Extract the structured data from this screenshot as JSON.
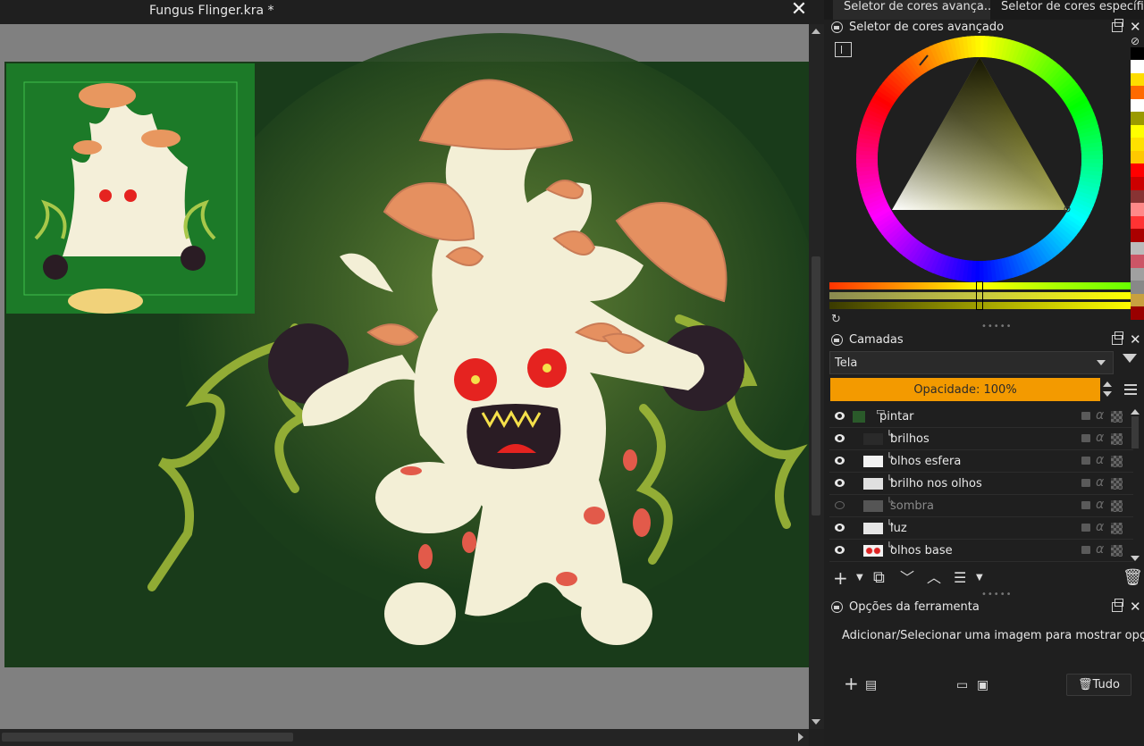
{
  "document": {
    "title": "Fungus Flinger.kra *",
    "close_glyph": "✕"
  },
  "dock_tabs": [
    {
      "label": "Seletor de cores avança..."
    },
    {
      "label": "Seletor de cores específi..."
    }
  ],
  "color_selector": {
    "title": "Seletor de cores avançado",
    "palette_colors": [
      "#000000",
      "#ffffff",
      "#ffdd00",
      "#ff6a00",
      "#ffffff",
      "#9a9a00",
      "#ffff00",
      "#ffe100",
      "#ffc800",
      "#ff0000",
      "#cc0000",
      "#883333",
      "#ff8888",
      "#ff3333",
      "#aa0000",
      "#bbbbbb",
      "#cc5566",
      "#a0a0a0",
      "#888888",
      "#c8a040",
      "#990000"
    ]
  },
  "layers": {
    "title": "Camadas",
    "blend_mode": "Tela",
    "opacity_label": "Opacidade:  100%",
    "items": [
      {
        "name": "pintar",
        "visible": true
      },
      {
        "name": "brilhos",
        "visible": true
      },
      {
        "name": "olhos esfera",
        "visible": true
      },
      {
        "name": "brilho nos olhos",
        "visible": true
      },
      {
        "name": "sombra",
        "visible": false
      },
      {
        "name": "luz",
        "visible": true
      },
      {
        "name": "olhos base",
        "visible": true
      }
    ]
  },
  "tool_options": {
    "title": "Opções da ferramenta",
    "message": "Adicionar/Selecionar uma imagem para mostrar opções",
    "all_button": "Tudo"
  }
}
